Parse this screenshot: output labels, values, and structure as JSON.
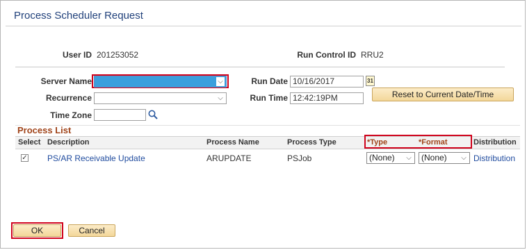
{
  "title": "Process Scheduler Request",
  "user": {
    "user_id_label": "User ID",
    "user_id": "201253052",
    "run_control_label": "Run Control ID",
    "run_control": "RRU2"
  },
  "form": {
    "server_name_label": "Server Name",
    "recurrence_label": "Recurrence",
    "time_zone_label": "Time Zone",
    "run_date_label": "Run Date",
    "run_date": "10/16/2017",
    "run_time_label": "Run Time",
    "run_time": "12:42:19PM",
    "reset_button": "Reset to Current Date/Time",
    "calendar_icon_text": "31"
  },
  "process_list": {
    "title": "Process List",
    "headers": [
      "Select",
      "Description",
      "Process Name",
      "Process Type",
      "*Type",
      "*Format",
      "Distribution"
    ],
    "rows": [
      {
        "select_mark": "✓",
        "description": "PS/AR Receivable Update",
        "process_name": "ARUPDATE",
        "process_type": "PSJob",
        "type": "(None)",
        "format": "(None)",
        "distribution": "Distribution"
      }
    ]
  },
  "buttons": {
    "ok": "OK",
    "cancel": "Cancel"
  },
  "icons": {
    "search": "search-icon",
    "calendar": "calendar-icon",
    "dropdown": "chevron-down-icon"
  },
  "colors": {
    "title": "#21417b",
    "highlight_select": "#3b9fdd",
    "outline_red": "#d0021b",
    "section_title": "#a0441a",
    "link": "#1f4b9e"
  }
}
